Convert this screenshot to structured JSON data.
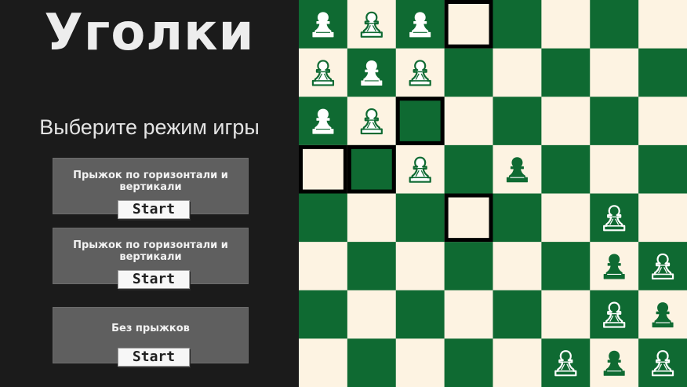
{
  "title": "Уголки",
  "subtitle": "Выберите режим игры",
  "modes": [
    {
      "label": "Прыжок по горизонтали и вертикали",
      "button": "Start"
    },
    {
      "label": "Прыжок по горизонтали и вертикали",
      "button": "Start"
    },
    {
      "label": "Без прыжков",
      "button": "Start"
    }
  ],
  "board": {
    "size": 8,
    "colors": {
      "light": "#fdf3e2",
      "dark": "#0f6a32",
      "highlight": "#000000"
    },
    "pieces": [
      {
        "row": 0,
        "col": 0,
        "style": "solid"
      },
      {
        "row": 0,
        "col": 1,
        "style": "outline"
      },
      {
        "row": 0,
        "col": 2,
        "style": "solid"
      },
      {
        "row": 1,
        "col": 0,
        "style": "outline"
      },
      {
        "row": 1,
        "col": 1,
        "style": "solid"
      },
      {
        "row": 1,
        "col": 2,
        "style": "outline"
      },
      {
        "row": 2,
        "col": 0,
        "style": "solid"
      },
      {
        "row": 2,
        "col": 1,
        "style": "outline"
      },
      {
        "row": 3,
        "col": 2,
        "style": "outline"
      },
      {
        "row": 3,
        "col": 4,
        "style": "solid"
      },
      {
        "row": 4,
        "col": 6,
        "style": "outline"
      },
      {
        "row": 5,
        "col": 6,
        "style": "solid"
      },
      {
        "row": 5,
        "col": 7,
        "style": "outline"
      },
      {
        "row": 6,
        "col": 6,
        "style": "outline"
      },
      {
        "row": 6,
        "col": 7,
        "style": "solid"
      },
      {
        "row": 7,
        "col": 5,
        "style": "outline"
      },
      {
        "row": 7,
        "col": 6,
        "style": "solid"
      },
      {
        "row": 7,
        "col": 7,
        "style": "outline"
      }
    ],
    "highlighted": [
      {
        "row": 0,
        "col": 3
      },
      {
        "row": 2,
        "col": 2
      },
      {
        "row": 3,
        "col": 0
      },
      {
        "row": 3,
        "col": 1
      },
      {
        "row": 4,
        "col": 3
      }
    ]
  }
}
